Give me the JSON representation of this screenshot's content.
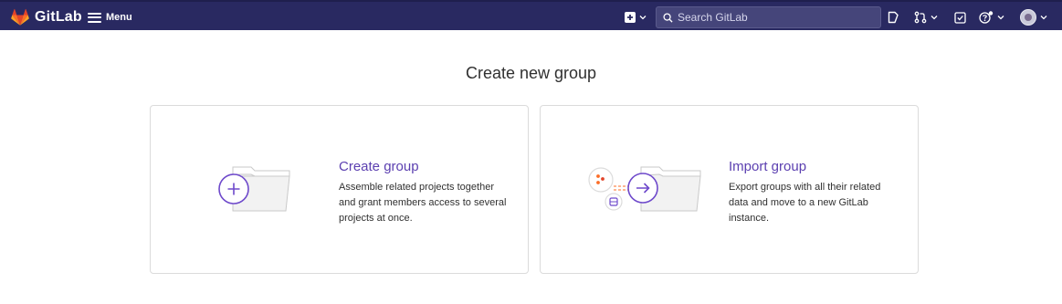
{
  "navbar": {
    "brand_name": "GitLab",
    "menu_label": "Menu",
    "search_placeholder": "Search GitLab",
    "icons": [
      "gitlab-logo",
      "hamburger-icon",
      "plus-square-icon",
      "chevron-down-icon",
      "search-icon",
      "issues-icon",
      "merge-request-icon",
      "todo-icon",
      "help-icon",
      "avatar"
    ],
    "bg_color": "#292961"
  },
  "main": {
    "title": "Create new group",
    "cards": [
      {
        "title": "Create group",
        "description": "Assemble related projects together and grant members access to several projects at once."
      },
      {
        "title": "Import group",
        "description": "Export groups with all their related data and move to a new GitLab instance."
      }
    ],
    "accent_color": "#5b3fb0"
  }
}
